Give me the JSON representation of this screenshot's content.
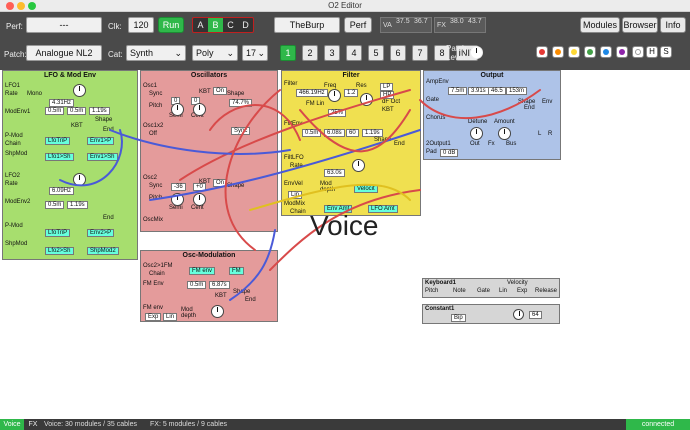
{
  "window": {
    "title": "O2 Editor"
  },
  "toolbar": {
    "perf_label": "Perf:",
    "perf_value": "---",
    "clk_label": "Clk:",
    "clk_value": "120",
    "run_label": "Run",
    "slots": [
      "A",
      "B",
      "C",
      "D"
    ],
    "active_slot": "B",
    "perf_name": "TheBurp",
    "perf_button": "Perf",
    "va_label": "VA",
    "va_values": [
      "37.5",
      "36.7"
    ],
    "fx_label": "FX",
    "fx_values": [
      "38.0",
      "43.7"
    ],
    "modules_label": "Modules",
    "browser_label": "Browser",
    "info_label": "Info",
    "patch_label": "Patch:",
    "patch_value": "Analogue NL2",
    "cat_label": "Cat:",
    "cat_value": "Synth",
    "poly_value": "Poly",
    "voices_value": "17",
    "variations": [
      "1",
      "2",
      "3",
      "4",
      "5",
      "6",
      "7",
      "8",
      "INIT"
    ],
    "active_variation": "1",
    "patch_level_label": "Patch Level:",
    "colors": [
      "#e53935",
      "#fb8c00",
      "#fdd835",
      "#43a047",
      "#1e88e5",
      "#8e24aa",
      "#ffffff",
      "#111111"
    ],
    "h_label": "H",
    "s_label": "S"
  },
  "canvas": {
    "voice_label": "Voice"
  },
  "modules": {
    "lfo_env": {
      "title": "LFO & Mod Env"
    },
    "oscillators": {
      "title": "Oscillators"
    },
    "filter": {
      "title": "Filter"
    },
    "output": {
      "title": "Output"
    },
    "osc_mod": {
      "title": "Osc-Modulation"
    },
    "keyboard": {
      "title": "Keyboard1",
      "items": [
        "Pitch",
        "Note",
        "Gate",
        "Lin",
        "Exp",
        "Release"
      ],
      "velocity": "Velocity"
    },
    "constant": {
      "title": "Constant1",
      "mode": "Bip",
      "value": "64"
    },
    "lfo1": {
      "name": "LFO1",
      "rate": "Rate",
      "mode": "Mono",
      "value": "4.31Hz",
      "r": "Lo"
    },
    "modenv1": {
      "name": "ModEnv1",
      "a": "0.5m",
      "d": "0.5m",
      "s": "1.19s",
      "kbt": "KBT",
      "shape": "Shape",
      "end": "End"
    },
    "pmod": {
      "name": "P-Mod",
      "chain": "Chain",
      "exp": "Exp",
      "a": "LfoTriP",
      "b": "Env1>P"
    },
    "shpmod": {
      "name": "ShpMod",
      "a": "Lfo1>Sh",
      "b": "Env1>Sh"
    },
    "lfo2": {
      "name": "LFO2",
      "rate": "Rate",
      "value": "6.09Hz",
      "r": "Lo"
    },
    "modenv2": {
      "name": "ModEnv2",
      "a": "0.5m",
      "s": "1.19s",
      "end": "End"
    },
    "pmod2": {
      "name": "P-Mod",
      "a": "LfoTriP",
      "b": "Env2>P"
    },
    "shpmod2": {
      "name": "ShpMod",
      "a": "Lfo2>Sh",
      "b": "ShpMod2"
    },
    "osc1": {
      "name": "Osc1",
      "sync": "Sync",
      "pitch": "Pitch",
      "kbt": "KBT",
      "on": "On",
      "semi": "Semi",
      "cent": "Cent",
      "shape": "Shape",
      "shape_val": "74.7%",
      "vals": [
        "0",
        "0"
      ]
    },
    "osc1x2": {
      "name": "Osc1x2",
      "off": "Off",
      "sync": "Sync"
    },
    "osc2": {
      "name": "Osc2",
      "sync": "Sync",
      "pitch": "Pitch",
      "kbt": "KBT",
      "on": "On",
      "semi": "Semi",
      "cent": "Cent",
      "shape": "Shape",
      "vals": [
        "-36",
        "+0"
      ]
    },
    "oscmix": {
      "name": "OscMix"
    },
    "osc2fm": {
      "name": "Osc2>1FM",
      "chain": "Chain",
      "a": "FM env",
      "b": "FM"
    },
    "fmenv": {
      "name": "FM Env",
      "a": "0.5m",
      "d": "6.87s",
      "shape": "Shape",
      "kbt": "KBT",
      "end": "End"
    },
    "fmamt": {
      "name": "FM env",
      "mod": "Mod depth",
      "exp": "Exp",
      "lin": "Lin"
    },
    "filt": {
      "name": "Filter",
      "freq": "Freq",
      "freq_val": "466.19Hz",
      "res": "Res",
      "res_val": "1.2",
      "fm": "FM Lin",
      "fm_val": "25%",
      "df": "dF Oct",
      "kbt": "KBT",
      "lp": "LP",
      "lp2": "HP"
    },
    "filtenv": {
      "name": "FiltEnv",
      "vals": [
        "0.5m",
        "6.08s",
        "60",
        "1.19s"
      ],
      "shape": "Shape",
      "end": "End"
    },
    "filtlfo": {
      "name": "FiltLFO",
      "rate": "Rate",
      "val": "63.0s"
    },
    "envvel": {
      "name": "EnvVel",
      "mod": "Mod depth",
      "vel": "Velocit",
      "lin": "Lin"
    },
    "modmix": {
      "name": "ModMix",
      "chain": "Chain",
      "a": "Env Amt",
      "b": "LFO Amt"
    },
    "ampenv": {
      "name": "AmpEnv",
      "vals": [
        "7.5m",
        "3.91s",
        "46.5",
        "153m"
      ],
      "shape": "Shape",
      "env": "Env",
      "gate": "Gate",
      "end": "End"
    },
    "chorus": {
      "name": "Chorus",
      "detune": "Detune",
      "amount": "Amount"
    },
    "output2": {
      "name": "2Output1",
      "pad": "Pad",
      "pad_val": "0 dB",
      "out": "Out",
      "fx": "Fx",
      "bus": "Bus",
      "vals": [
        "L",
        "R"
      ]
    }
  },
  "status": {
    "voice_tab": "Voice",
    "fx_tab": "FX",
    "voice_info": "Voice: 30 modules / 35 cables",
    "fx_info": "FX: 5 modules / 9 cables",
    "connection": "connected"
  }
}
